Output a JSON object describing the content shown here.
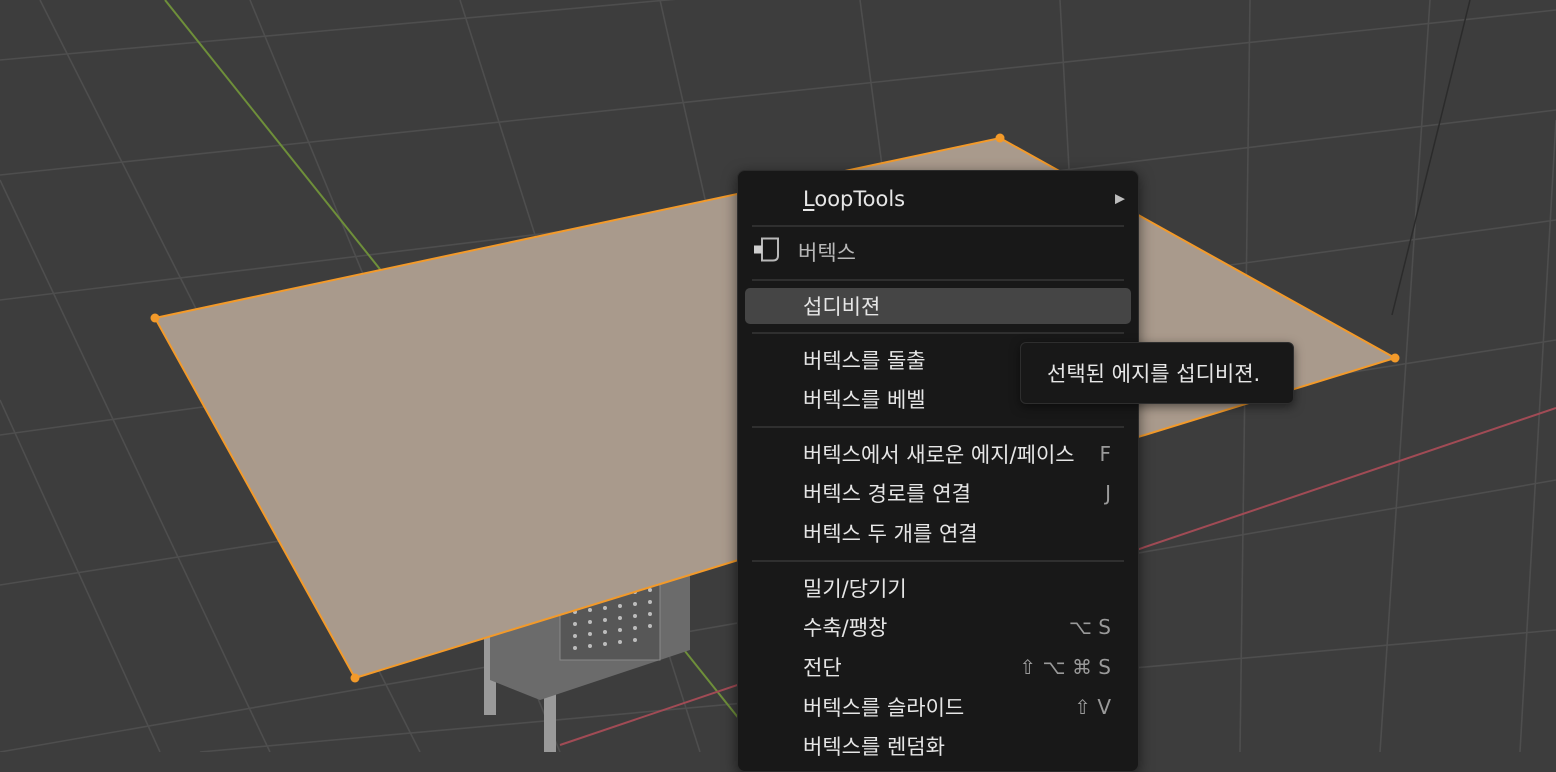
{
  "colors": {
    "background": "#3d3d3d",
    "grid": "#4f4f4f",
    "axis_y": "#6e8f3a",
    "axis_x": "#a14b55",
    "plane_fill": "#a99a8c",
    "selection": "#f39a2a",
    "menu_bg": "#181818",
    "menu_highlight": "#454545"
  },
  "context_menu": {
    "submenu": {
      "label_first": "L",
      "label_rest": "oopTools",
      "arrow": "▶"
    },
    "section_header": {
      "icon": "vertex-icon",
      "label": "버텍스"
    },
    "items": [
      {
        "label": "섭디비젼",
        "shortcut": "",
        "highlighted": true
      },
      {
        "label": "버텍스를 돌출",
        "shortcut": ""
      },
      {
        "label": "버텍스를 베벨",
        "shortcut": ""
      },
      {
        "label": "버텍스에서 새로운 에지/페이스",
        "shortcut": "F"
      },
      {
        "label": "버텍스 경로를 연결",
        "shortcut": "J"
      },
      {
        "label": "버텍스 두 개를 연결",
        "shortcut": ""
      },
      {
        "label": "밀기/당기기",
        "shortcut": ""
      },
      {
        "label": "수축/팽창",
        "shortcut": "⌥ S"
      },
      {
        "label": "전단",
        "shortcut": "⇧ ⌥ ⌘ S"
      },
      {
        "label": "버텍스를 슬라이드",
        "shortcut": "⇧ V"
      },
      {
        "label": "버텍스를 렌덤화",
        "shortcut": ""
      }
    ]
  },
  "tooltip": {
    "text": "선택된 에지를 섭디비젼."
  }
}
